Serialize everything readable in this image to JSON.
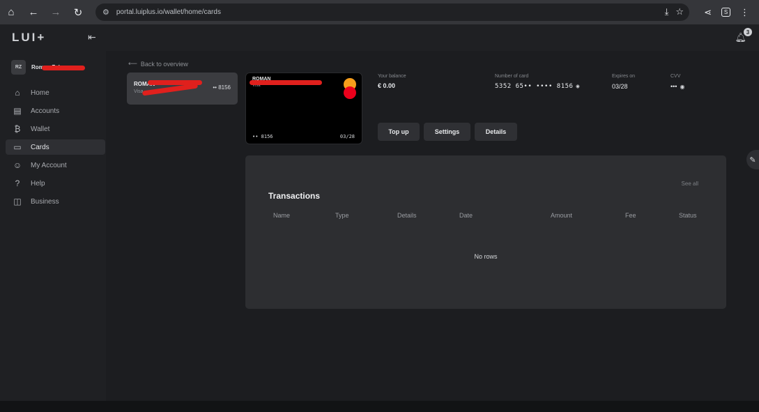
{
  "browser": {
    "url": "portal.luiplus.io/wallet/home/cards",
    "icons": [
      "home-icon",
      "back-arrow-icon",
      "forward-arrow-icon",
      "reload-icon",
      "site-settings-icon",
      "install-icon",
      "bookmark-star-icon",
      "share-icon",
      "extension-icon",
      "menu-kebab-icon"
    ],
    "extension_badge": "S"
  },
  "app": {
    "logo": "LUI+",
    "notifications_count": "3",
    "user": {
      "initials": "RZ",
      "name": "Roman Zel"
    },
    "nav": [
      {
        "label": "Home",
        "icon": "home-icon"
      },
      {
        "label": "Accounts",
        "icon": "accounts-icon"
      },
      {
        "label": "Wallet",
        "icon": "bitcoin-icon"
      },
      {
        "label": "Cards",
        "icon": "card-icon",
        "active": true
      },
      {
        "label": "My Account",
        "icon": "user-icon"
      },
      {
        "label": "Help",
        "icon": "help-icon"
      },
      {
        "label": "Business",
        "icon": "briefcase-icon"
      }
    ]
  },
  "cards_page": {
    "back_label": "Back to overview",
    "mini_card": {
      "holder": "ROMAN",
      "type": "Visa",
      "last4": "•• 8156"
    },
    "card": {
      "holder": "ROMAN",
      "type": "Visa",
      "number": "•• 8156",
      "expiry": "03/28"
    },
    "balance": {
      "label": "Your balance",
      "value": "€ 0.00"
    },
    "card_number": {
      "label": "Number of card",
      "value": "5352 65•• •••• 8156"
    },
    "expires": {
      "label": "Expires on",
      "value": "03/28"
    },
    "cvv": {
      "label": "CVV",
      "value": "•••"
    },
    "buttons": {
      "top_up": "Top up",
      "settings": "Settings",
      "details": "Details"
    }
  },
  "transactions": {
    "title": "Transactions",
    "see_all": "See all",
    "columns": [
      "Name",
      "Type",
      "Details",
      "Date",
      "Amount",
      "Fee",
      "Status"
    ],
    "empty": "No rows"
  },
  "colors": {
    "background": "#1c1d20",
    "sidebar": "#1f2023",
    "panel": "#2d2e31",
    "redaction": "#e0201d",
    "mastercard_orange": "#f79e1b",
    "mastercard_red": "#eb001b"
  }
}
